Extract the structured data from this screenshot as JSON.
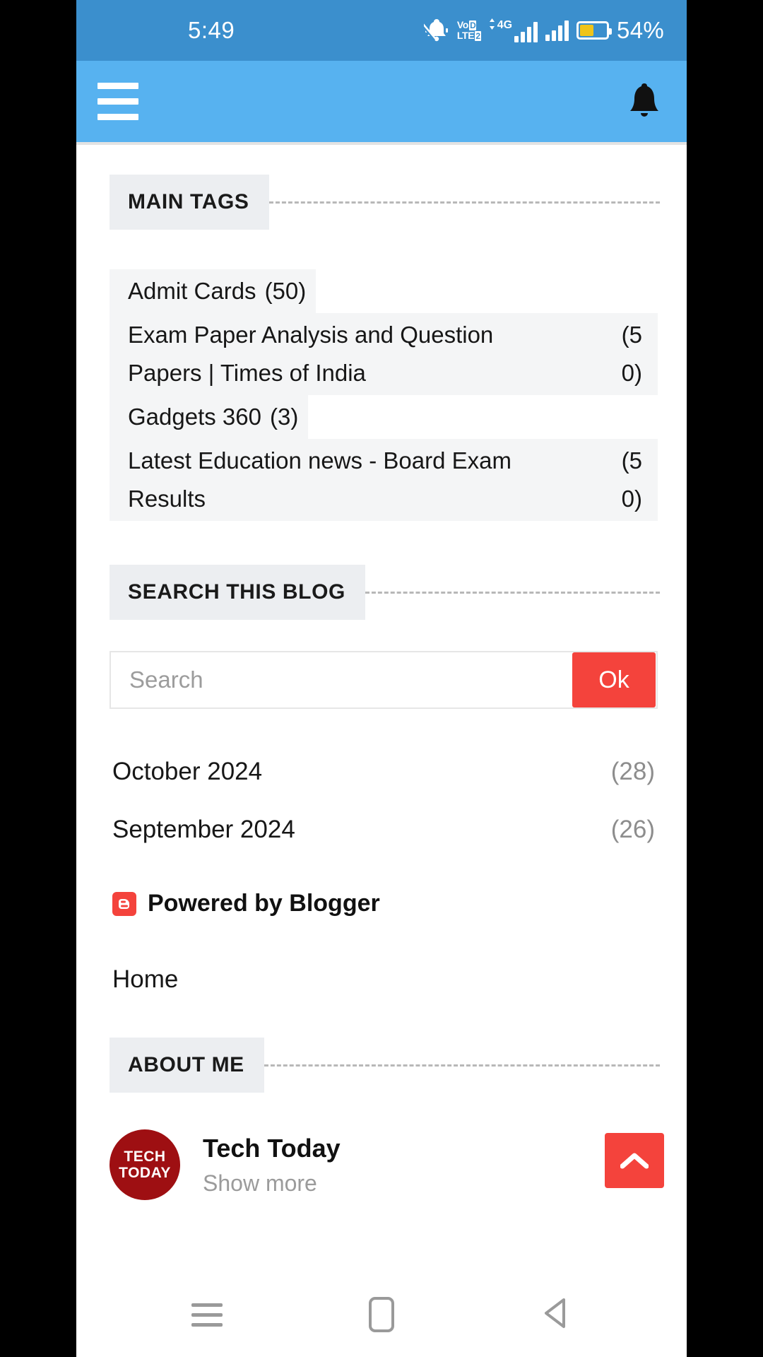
{
  "status_bar": {
    "time": "5:49",
    "battery_percent": "54%",
    "battery_level": 54,
    "icons": [
      "silent-bell-icon",
      "volte-icon",
      "data-updown-icon",
      "signal-4g-icon",
      "signal-icon",
      "battery-icon"
    ],
    "volte": {
      "line1": "Vo",
      "line1_box": "D",
      "line2": "LTE",
      "line2_box": "2"
    },
    "network_label": "4G",
    "background": "#3b8fcd"
  },
  "app_bar": {
    "menu_icon": "hamburger-icon",
    "notification_icon": "bell-icon",
    "background": "#57b2f0"
  },
  "main_tags": {
    "title": "MAIN TAGS",
    "items": [
      {
        "label": "Admit Cards",
        "count": "(50)",
        "wrap": false
      },
      {
        "label": "Exam Paper Analysis and Question Papers | Times of India",
        "count": "(5\n0)",
        "wrap": true
      },
      {
        "label": "Gadgets 360",
        "count": "(3)",
        "wrap": false
      },
      {
        "label": "Latest Education news - Board Exam Results",
        "count": "(5\n0)",
        "wrap": true
      }
    ]
  },
  "search": {
    "title": "SEARCH THIS BLOG",
    "placeholder": "Search",
    "value": "",
    "button_label": "Ok",
    "button_color": "#f4433c"
  },
  "archive": {
    "items": [
      {
        "label": "October 2024",
        "count": "(28)"
      },
      {
        "label": "September 2024",
        "count": "(26)"
      }
    ]
  },
  "blogger": {
    "label": "Powered by Blogger",
    "logo_icon": "blogger-icon",
    "logo_color": "#f4433c"
  },
  "home_link": {
    "label": "Home"
  },
  "about_me": {
    "title": "ABOUT ME",
    "avatar_line1": "TECH",
    "avatar_line2": "TODAY",
    "avatar_icon": "avatar",
    "name": "Tech Today",
    "show_more": "Show more"
  },
  "scroll_top": {
    "icon": "chevron-up-icon",
    "color": "#f4433c"
  },
  "nav_bar": {
    "recent_icon": "recents-icon",
    "home_icon": "home-icon",
    "back_icon": "back-icon"
  }
}
